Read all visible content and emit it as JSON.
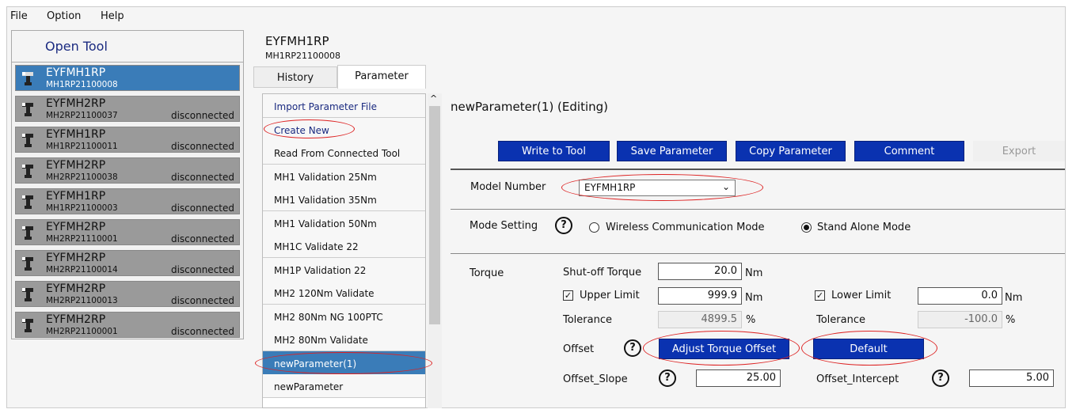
{
  "menu": {
    "file": "File",
    "option": "Option",
    "help": "Help"
  },
  "sidebar": {
    "open_tool": "Open Tool",
    "tools": [
      {
        "name": "EYFMH1RP",
        "serial": "MH1RP21100008",
        "status": ""
      },
      {
        "name": "EYFMH2RP",
        "serial": "MH2RP21100037",
        "status": "disconnected"
      },
      {
        "name": "EYFMH1RP",
        "serial": "MH1RP21100011",
        "status": "disconnected"
      },
      {
        "name": "EYFMH2RP",
        "serial": "MH2RP21100038",
        "status": "disconnected"
      },
      {
        "name": "EYFMH1RP",
        "serial": "MH1RP21100003",
        "status": "disconnected"
      },
      {
        "name": "EYFMH2RP",
        "serial": "MH2RP21110001",
        "status": "disconnected"
      },
      {
        "name": "EYFMH2RP",
        "serial": "MH2RP21100014",
        "status": "disconnected"
      },
      {
        "name": "EYFMH2RP",
        "serial": "MH2RP21100013",
        "status": "disconnected"
      },
      {
        "name": "EYFMH2RP",
        "serial": "MH2RP21100001",
        "status": "disconnected"
      }
    ]
  },
  "header": {
    "model": "EYFMH1RP",
    "serial": "MH1RP21100008"
  },
  "tabs": {
    "history": "History",
    "parameter": "Parameter"
  },
  "param_list": [
    "Import Parameter File",
    "Create New",
    "Read From Connected Tool",
    "MH1 Validation 25Nm",
    "MH1 Validation 35Nm",
    "MH1 Validation 50Nm",
    "MH1C Validate 22",
    "MH1P Validation 22",
    "MH2 120Nm Validate",
    "MH2 80Nm NG 100PTC",
    "MH2 80Nm Validate",
    "newParameter(1)",
    "newParameter"
  ],
  "editor": {
    "title": "newParameter(1) (Editing)",
    "buttons": {
      "write": "Write to Tool",
      "save": "Save Parameter",
      "copy": "Copy Parameter",
      "comment": "Comment",
      "export": "Export"
    },
    "model_label": "Model Number",
    "model_value": "EYFMH1RP",
    "mode_label": "Mode Setting",
    "mode_wireless": "Wireless Communication Mode",
    "mode_standalone": "Stand Alone Mode",
    "torque": {
      "section": "Torque",
      "shutoff_label": "Shut-off Torque",
      "shutoff": "20.0",
      "unit": "Nm",
      "upper_label": "Upper Limit",
      "upper": "999.9",
      "lower_label": "Lower Limit",
      "lower": "0.0",
      "tol_label": "Tolerance",
      "tol_upper": "4899.5",
      "tol_lower": "-100.0",
      "pct": "%",
      "offset_label": "Offset",
      "adjust": "Adjust Torque Offset",
      "default": "Default",
      "slope_label": "Offset_Slope",
      "slope": "25.00",
      "intercept_label": "Offset_Intercept",
      "intercept": "5.00",
      "help": "?"
    }
  },
  "colors": {
    "accent": "#0a32b0",
    "selected": "#3a7cb8",
    "annotation": "#dd2222"
  }
}
